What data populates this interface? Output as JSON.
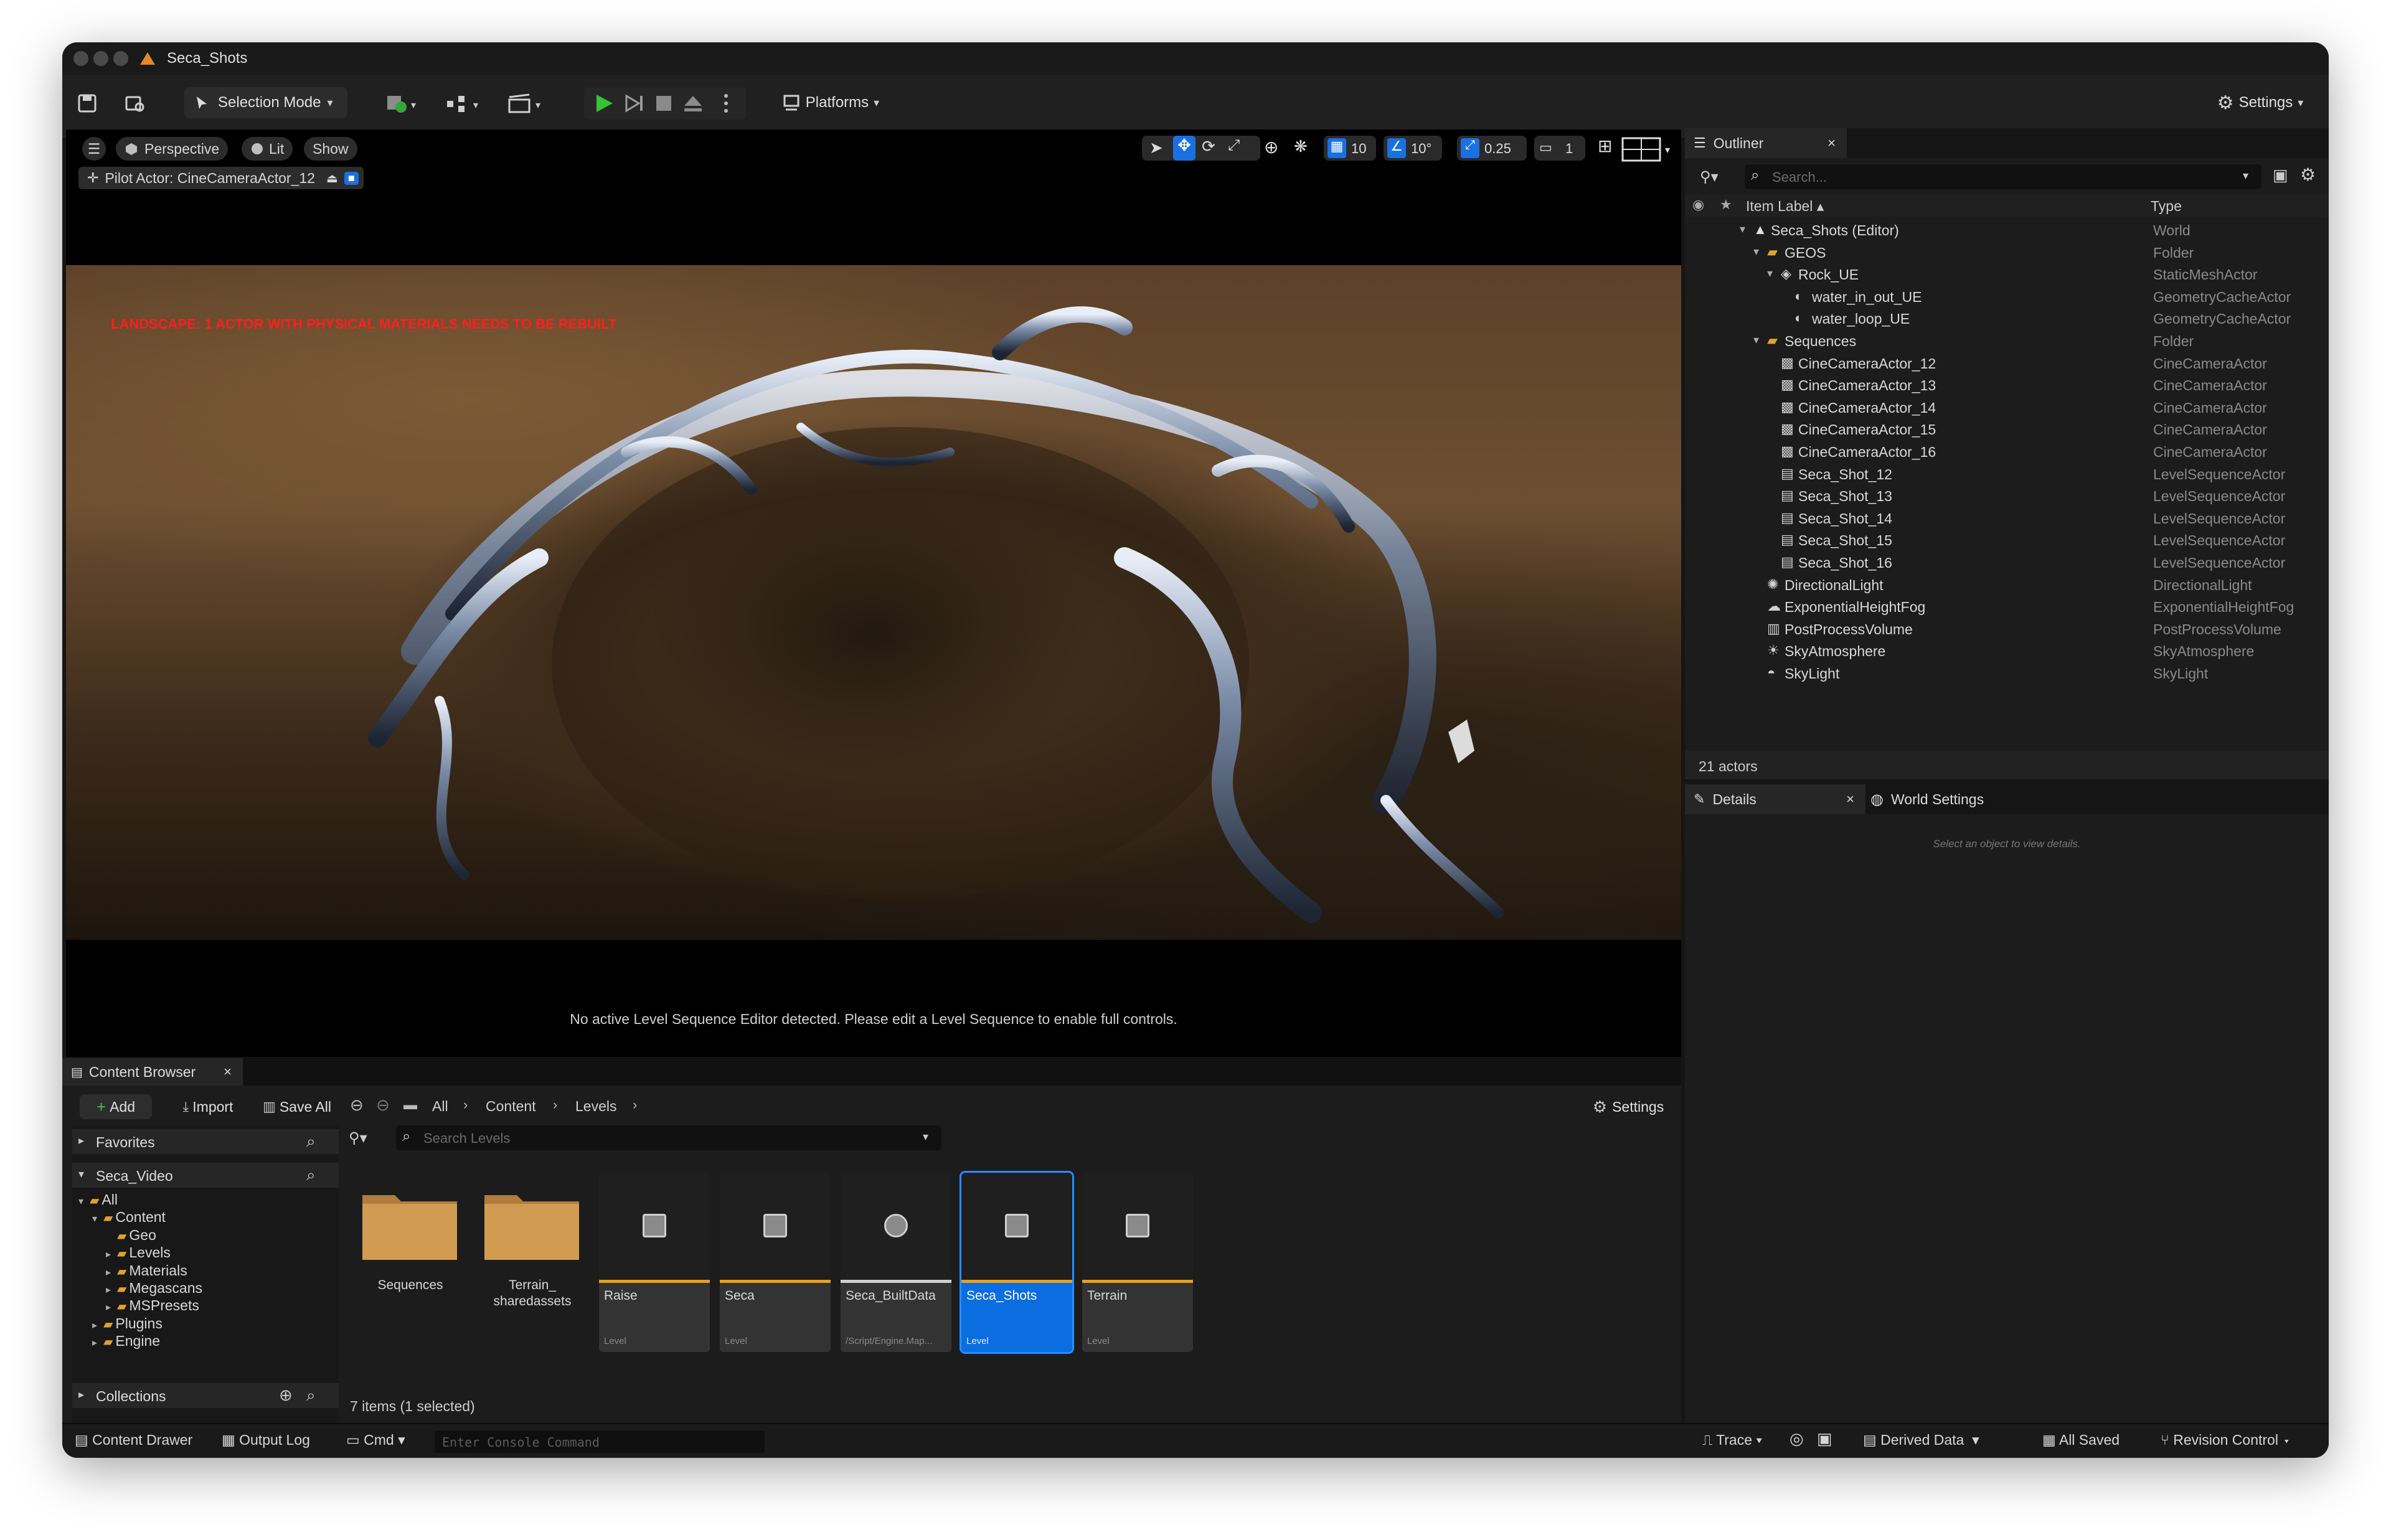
{
  "window": {
    "title": "Seca_Shots"
  },
  "toolbar": {
    "selection_mode": "Selection Mode",
    "platforms": "Platforms",
    "settings": "Settings"
  },
  "viewport": {
    "perspective": "Perspective",
    "lit": "Lit",
    "show": "Show",
    "pilot": "Pilot Actor: CineCameraActor_12",
    "grid_snap": "10",
    "angle_snap": "10°",
    "scale_snap": "0.25",
    "camera_speed": "1",
    "warning": "LANDSCAPE: 1 ACTOR WITH PHYSICAL MATERIALS NEEDS TO BE REBUILT",
    "message": "No active Level Sequence Editor detected. Please edit a Level Sequence to enable full controls."
  },
  "outliner": {
    "tab": "Outliner",
    "search_placeholder": "Search...",
    "col_label": "Item Label",
    "col_type": "Type",
    "rows": [
      {
        "label": "Seca_Shots (Editor)",
        "type": "World"
      },
      {
        "label": "GEOS",
        "type": "Folder"
      },
      {
        "label": "Rock_UE",
        "type": "StaticMeshActor"
      },
      {
        "label": "water_in_out_UE",
        "type": "GeometryCacheActor"
      },
      {
        "label": "water_loop_UE",
        "type": "GeometryCacheActor"
      },
      {
        "label": "Sequences",
        "type": "Folder"
      },
      {
        "label": "CineCameraActor_12",
        "type": "CineCameraActor"
      },
      {
        "label": "CineCameraActor_13",
        "type": "CineCameraActor"
      },
      {
        "label": "CineCameraActor_14",
        "type": "CineCameraActor"
      },
      {
        "label": "CineCameraActor_15",
        "type": "CineCameraActor"
      },
      {
        "label": "CineCameraActor_16",
        "type": "CineCameraActor"
      },
      {
        "label": "Seca_Shot_12",
        "type": "LevelSequenceActor"
      },
      {
        "label": "Seca_Shot_13",
        "type": "LevelSequenceActor"
      },
      {
        "label": "Seca_Shot_14",
        "type": "LevelSequenceActor"
      },
      {
        "label": "Seca_Shot_15",
        "type": "LevelSequenceActor"
      },
      {
        "label": "Seca_Shot_16",
        "type": "LevelSequenceActor"
      },
      {
        "label": "DirectionalLight",
        "type": "DirectionalLight"
      },
      {
        "label": "ExponentialHeightFog",
        "type": "ExponentialHeightFog"
      },
      {
        "label": "PostProcessVolume",
        "type": "PostProcessVolume"
      },
      {
        "label": "SkyAtmosphere",
        "type": "SkyAtmosphere"
      },
      {
        "label": "SkyLight",
        "type": "SkyLight"
      }
    ],
    "count": "21 actors"
  },
  "details": {
    "tab": "Details",
    "world_tab": "World Settings",
    "empty": "Select an object to view details."
  },
  "content_browser": {
    "tab": "Content Browser",
    "add": "Add",
    "import": "Import",
    "save_all": "Save All",
    "breadcrumb": [
      "All",
      "Content",
      "Levels"
    ],
    "settings": "Settings",
    "favorites": "Favorites",
    "project": "Seca_Video",
    "search_placeholder": "Search Levels",
    "tree": [
      "All",
      "Content",
      "Geo",
      "Levels",
      "Materials",
      "Megascans",
      "MSPresets",
      "Plugins",
      "Engine"
    ],
    "collections": "Collections",
    "folders": [
      {
        "name": "Sequences"
      },
      {
        "name": "Terrain_ sharedassets"
      }
    ],
    "assets": [
      {
        "name": "Raise",
        "sub": "Level"
      },
      {
        "name": "Seca",
        "sub": "Level"
      },
      {
        "name": "Seca_BuiltData",
        "sub": "/Script/Engine.Map..."
      },
      {
        "name": "Seca_Shots",
        "sub": "Level"
      },
      {
        "name": "Terrain",
        "sub": "Level"
      }
    ],
    "items_count": "7 items (1 selected)"
  },
  "statusbar": {
    "content_drawer": "Content Drawer",
    "output_log": "Output Log",
    "cmd": "Cmd",
    "console_placeholder": "Enter Console Command",
    "trace": "Trace",
    "derived_data": "Derived Data",
    "all_saved": "All Saved",
    "revision_control": "Revision Control"
  }
}
